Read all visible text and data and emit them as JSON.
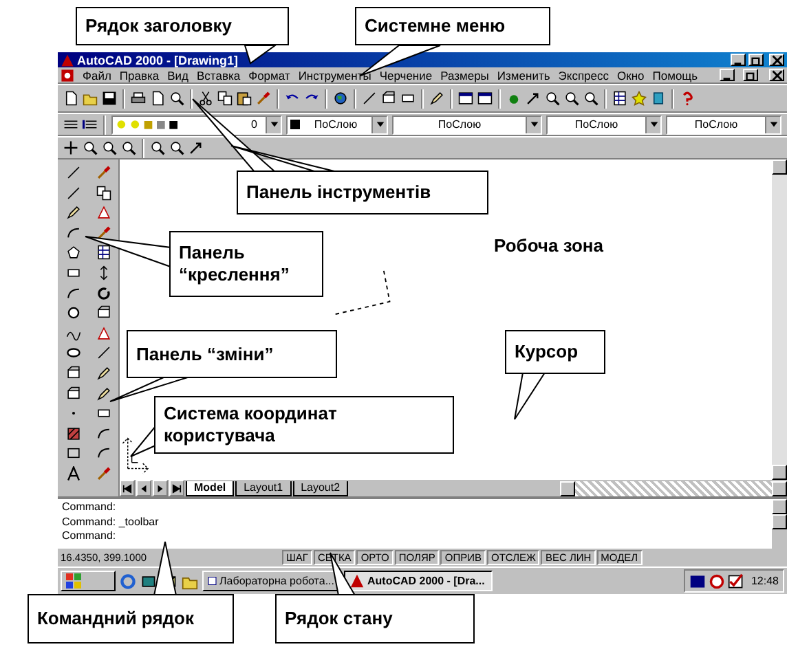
{
  "callouts": [
    {
      "text": "Рядок заголовку"
    },
    {
      "text": "Системне меню"
    },
    {
      "text": "Панель інструментів"
    },
    {
      "text": "Панель “креслення”"
    },
    {
      "text": "Панель “зміни”"
    },
    {
      "text": "Система координат користувача"
    },
    {
      "text": "Курсор"
    },
    {
      "text": "Командний рядок"
    },
    {
      "text": "Рядок стану"
    }
  ],
  "window": {
    "title": "AutoCAD 2000 - [Drawing1]"
  },
  "menu": [
    "Файл",
    "Правка",
    "Вид",
    "Вставка",
    "Формат",
    "Инструменты",
    "Черчение",
    "Размеры",
    "Изменить",
    "Экспресс",
    "Окно",
    "Помощь"
  ],
  "layer_toolbar": {
    "layer": "0",
    "dropdowns": [
      "ПоСлою",
      "ПоСлою",
      "ПоСлою",
      "ПоСлою"
    ]
  },
  "workspace_label": "Робоча зона",
  "tabs": [
    {
      "label": "Model",
      "selected": true
    },
    {
      "label": "Layout1",
      "selected": false
    },
    {
      "label": "Layout2",
      "selected": false
    }
  ],
  "command_lines": [
    "Command:",
    "Command: _toolbar",
    "Command:"
  ],
  "status_bar": {
    "coords": "16.4350, 399.1000",
    "toggles": [
      "ШАГ",
      "СЕТКА",
      "ОРТО",
      "ПОЛЯР",
      "ОПРИВ",
      "ОТСЛЕЖ",
      "ВЕС ЛИН",
      "МОДЕЛ"
    ]
  },
  "taskbar": {
    "tasks": [
      {
        "label": "Лабораторна робота...",
        "selected": false
      },
      {
        "label": "AutoCAD 2000 - [Dra...",
        "selected": true
      }
    ],
    "clock": "12:48"
  }
}
